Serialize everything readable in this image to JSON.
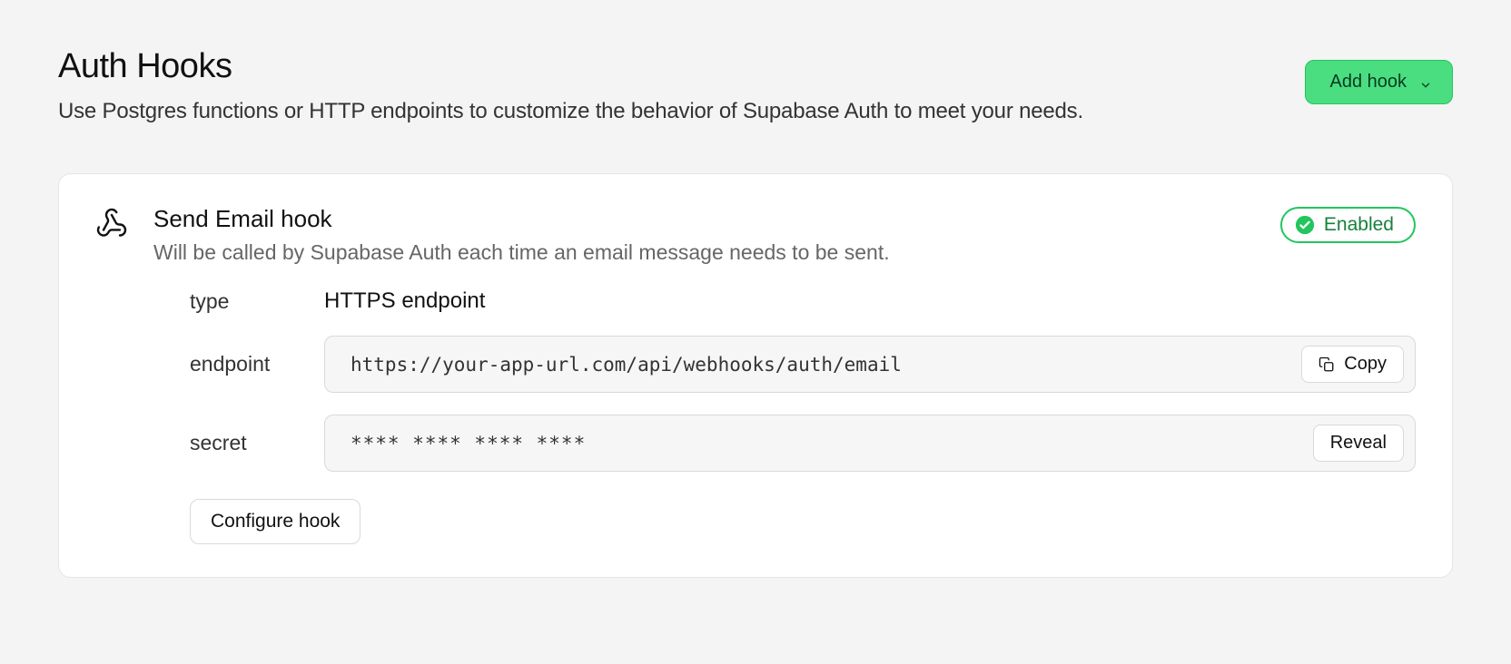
{
  "header": {
    "title": "Auth Hooks",
    "subtitle": "Use Postgres functions or HTTP endpoints to customize the behavior of Supabase Auth to meet your needs.",
    "add_button_label": "Add hook"
  },
  "hook": {
    "icon": "webhook-icon",
    "title": "Send Email hook",
    "description": "Will be called by Supabase Auth each time an email message needs to be sent.",
    "status_label": "Enabled",
    "fields": {
      "type": {
        "label": "type",
        "value": "HTTPS endpoint"
      },
      "endpoint": {
        "label": "endpoint",
        "value": "https://your-app-url.com/api/webhooks/auth/email",
        "copy_label": "Copy"
      },
      "secret": {
        "label": "secret",
        "masked_value": "**** **** **** ****",
        "reveal_label": "Reveal"
      }
    },
    "configure_label": "Configure hook"
  },
  "colors": {
    "accent_green": "#4ade80",
    "accent_green_border": "#22c55e",
    "status_text": "#16803c"
  }
}
